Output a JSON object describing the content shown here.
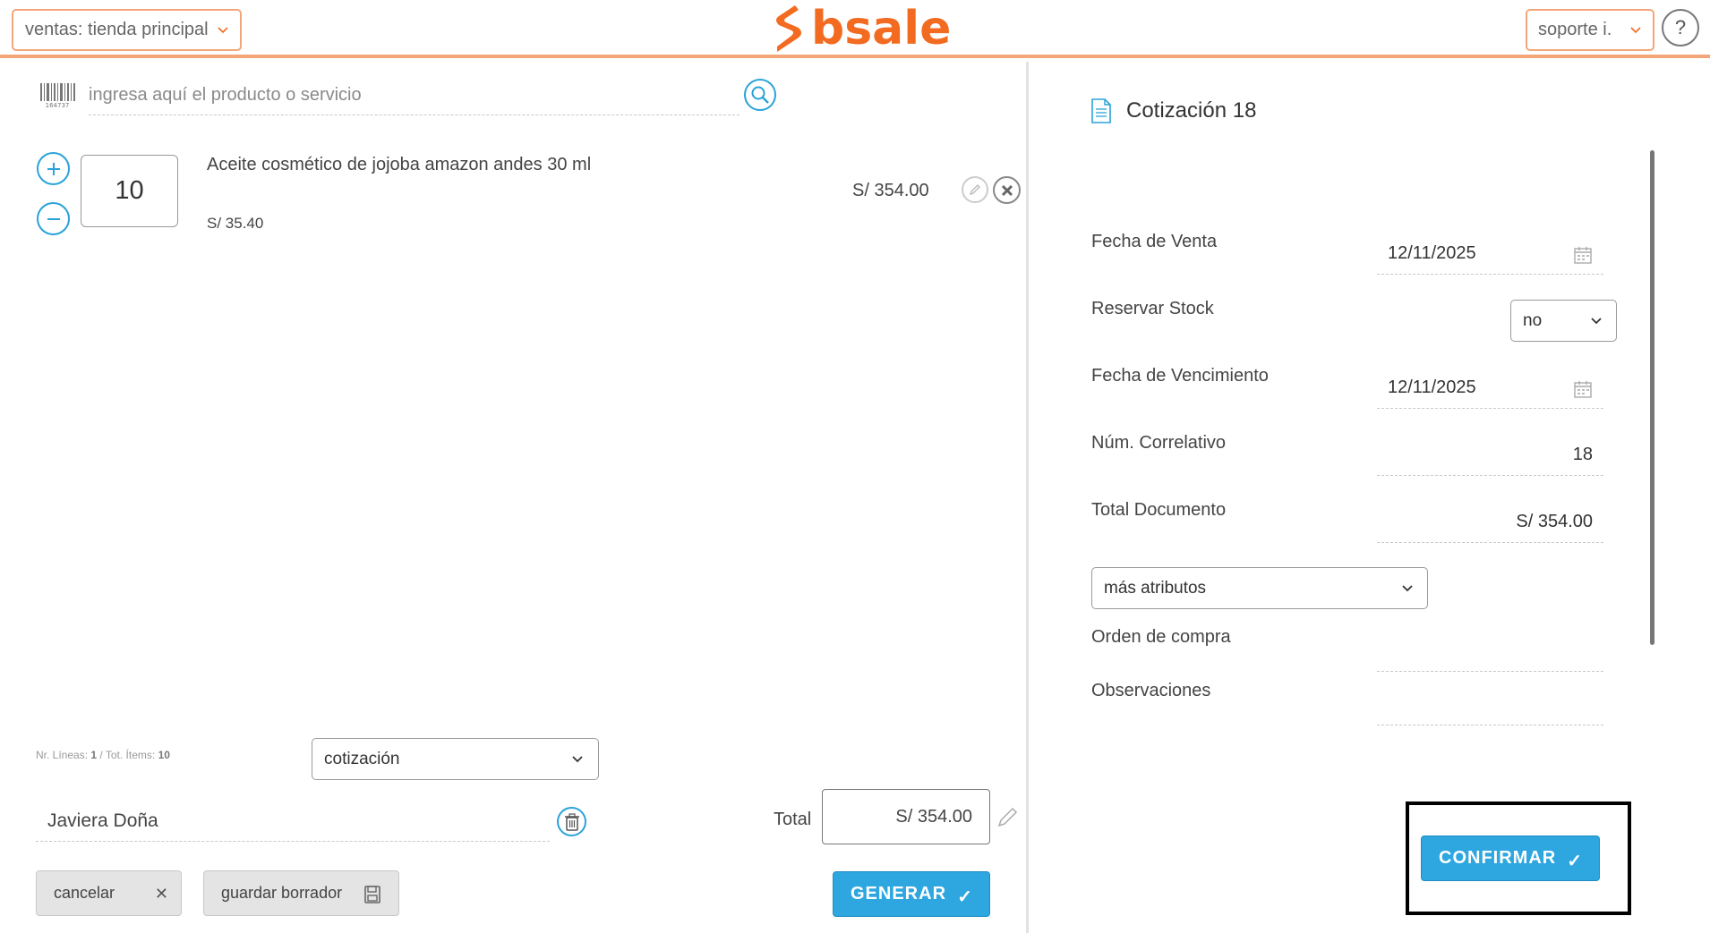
{
  "header": {
    "store_select": "ventas: tienda principal",
    "logo_text": "bsale",
    "user_select": "soporte i.",
    "help_label": "?"
  },
  "search": {
    "placeholder": "ingresa aquí el producto o servicio"
  },
  "line_items": [
    {
      "quantity": "10",
      "name": "Aceite cosmético de jojoba amazon andes 30 ml",
      "unit_price": "S/ 35.40",
      "total": "S/ 354.00"
    }
  ],
  "counters": {
    "lines_label": "Nr. Líneas:",
    "lines_value": "1",
    "items_label": "/ Tot. Ítems:",
    "items_value": "10"
  },
  "document_type": "cotización",
  "client_name": "Javiera Doña",
  "total": {
    "label": "Total",
    "value": "S/ 354.00"
  },
  "buttons": {
    "cancel": "cancelar",
    "save_draft": "guardar borrador",
    "generate": "GENERAR",
    "confirm": "CONFIRMAR"
  },
  "document_panel": {
    "title": "Cotización 18",
    "fields": {
      "sale_date_label": "Fecha de Venta",
      "sale_date_value": "12/11/2025",
      "reserve_stock_label": "Reservar Stock",
      "reserve_stock_value": "no",
      "due_date_label": "Fecha de Vencimiento",
      "due_date_value": "12/11/2025",
      "correlative_label": "Núm. Correlativo",
      "correlative_value": "18",
      "doc_total_label": "Total Documento",
      "doc_total_value": "S/ 354.00",
      "more_attributes": "más atributos",
      "purchase_order_label": "Orden de compra",
      "purchase_order_value": "",
      "notes_label": "Observaciones",
      "notes_value": ""
    }
  },
  "colors": {
    "brand_orange": "#f26b21",
    "accent_blue": "#2ea6df",
    "border_orange": "#f5a679"
  }
}
